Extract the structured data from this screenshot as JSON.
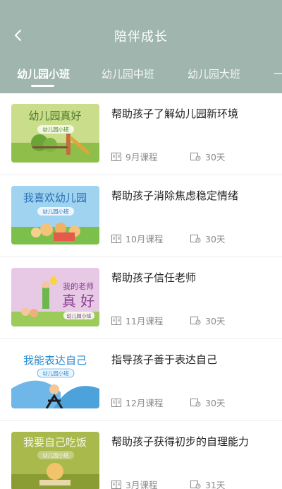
{
  "header": {
    "title": "陪伴成长"
  },
  "tabs": [
    {
      "label": "幼儿园小班"
    },
    {
      "label": "幼儿园中班"
    },
    {
      "label": "幼儿园大班"
    },
    {
      "label": "一"
    }
  ],
  "courses": [
    {
      "title": "帮助孩子了解幼儿园新环境",
      "course_count": "9月课程",
      "duration": "30天",
      "thumb_title": "幼儿园真好",
      "thumb_badge": "幼儿园小班"
    },
    {
      "title": "帮助孩子消除焦虑稳定情绪",
      "course_count": "10月课程",
      "duration": "30天",
      "thumb_title": "我喜欢幼儿园",
      "thumb_badge": "幼儿园小班"
    },
    {
      "title": "帮助孩子信任老师",
      "course_count": "11月课程",
      "duration": "30天",
      "thumb_title_1": "我的老师",
      "thumb_title_2": "真 好",
      "thumb_badge": "幼儿园小班"
    },
    {
      "title": "指导孩子善于表达自己",
      "course_count": "12月课程",
      "duration": "30天",
      "thumb_title": "我能表达自己",
      "thumb_badge": "幼儿园小班"
    },
    {
      "title": "帮助孩子获得初步的自理能力",
      "course_count": "3月课程",
      "duration": "31天",
      "thumb_title": "我要自己吃饭",
      "thumb_badge": "幼儿园小班"
    }
  ],
  "colors": {
    "header_bg": "#9fb5ae",
    "meta_text": "#8a8a8a"
  }
}
